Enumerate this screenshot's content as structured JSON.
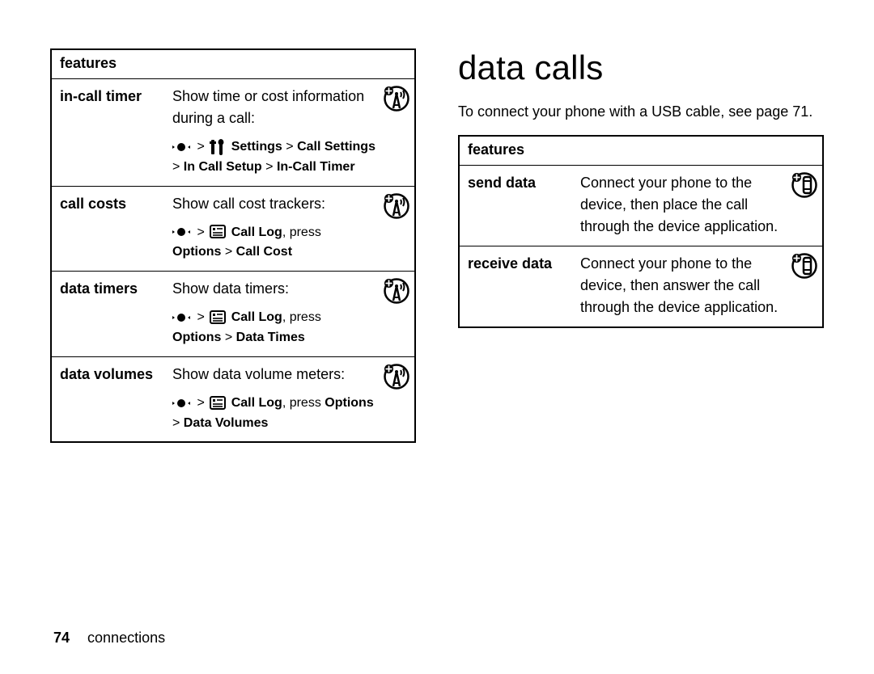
{
  "heading": "data calls",
  "intro_text": "To connect your phone with a USB cable, see page 71.",
  "left_table": {
    "header": "features",
    "rows": [
      {
        "name": "in-call timer",
        "desc": "Show time or cost information during a call:",
        "icon": "antenna-plus",
        "path_pre": "",
        "path_icons": "nav-tools",
        "path_bold1": "Settings",
        "path_sep1": " > ",
        "path_bold2": "Call Settings",
        "path_line2": "> ",
        "path_bold3": "In Call Setup",
        "path_sep2": " > ",
        "path_bold4": "In-Call Timer"
      },
      {
        "name": "call costs",
        "desc": "Show call cost trackers:",
        "icon": "antenna-plus",
        "path_icons": "nav-log",
        "path_bold1": "Call Log",
        "path_post1": ", press",
        "path_line2bold": "Options",
        "path_line2sep": " > ",
        "path_line2bold2": "Call Cost"
      },
      {
        "name": "data timers",
        "desc": "Show data timers:",
        "icon": "antenna-plus",
        "path_icons": "nav-log",
        "path_bold1": "Call Log",
        "path_post1": ", press",
        "path_line2bold": "Options",
        "path_line2sep": " > ",
        "path_line2bold2": "Data Times"
      },
      {
        "name": "data volumes",
        "desc": "Show data volume meters:",
        "icon": "antenna-plus",
        "path_icons": "nav-log",
        "path_bold1": "Call Log",
        "path_post1": ", press ",
        "path_post1bold": "Options",
        "path_line2": "> ",
        "path_line2bold2": "Data Volumes"
      }
    ]
  },
  "right_table": {
    "header": "features",
    "rows": [
      {
        "name": "send data",
        "desc": "Connect your phone to the device, then place the call through the device application.",
        "icon": "data-plus"
      },
      {
        "name": "receive data",
        "desc": "Connect your phone to the device, then answer the call through the device application.",
        "icon": "data-plus"
      }
    ]
  },
  "footer": {
    "page": "74",
    "section": "connections"
  }
}
